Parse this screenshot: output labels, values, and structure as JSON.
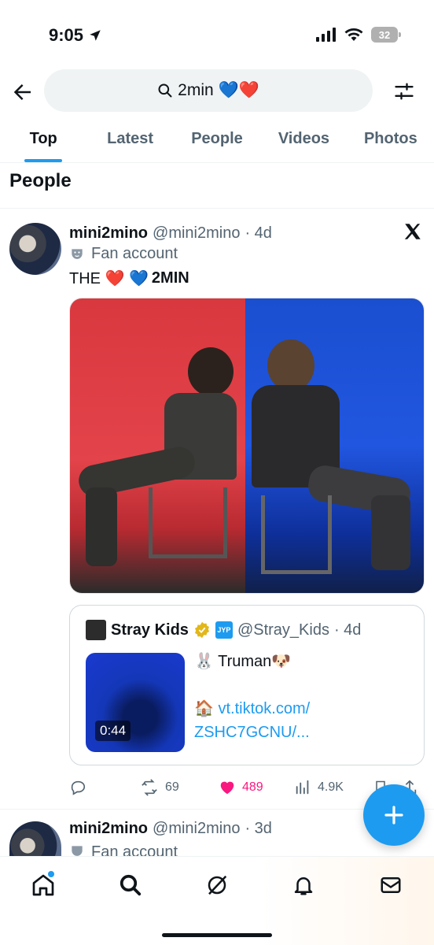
{
  "status_bar": {
    "time": "9:05",
    "battery": "32"
  },
  "search": {
    "query": "2min 💙❤️"
  },
  "tabs": [
    {
      "label": "Top",
      "active": true
    },
    {
      "label": "Latest",
      "active": false
    },
    {
      "label": "People",
      "active": false
    },
    {
      "label": "Videos",
      "active": false
    },
    {
      "label": "Photos",
      "active": false
    }
  ],
  "section_title": "People",
  "tweet": {
    "display_name": "mini2mino",
    "handle": "@mini2mino",
    "time": "· 4d",
    "account_label": "Fan account",
    "text_prefix": "THE ❤️ 💙",
    "text_bold": "2MIN",
    "quote": {
      "display_name": "Stray Kids",
      "handle": "@Stray_Kids",
      "time": "· 4d",
      "video_duration": "0:44",
      "line1": "🐰 Truman🐶",
      "line2_prefix": "🏠 ",
      "link_line1": "vt.tiktok.com/",
      "link_line2": "ZSHC7GCNU/..."
    },
    "actions": {
      "replies": "",
      "retweets": "69",
      "likes": "489",
      "views": "4.9K"
    }
  },
  "tweet2": {
    "display_name": "mini2mino",
    "handle": "@mini2mino",
    "time": "· 3d",
    "account_label": "Fan account"
  },
  "colors": {
    "accent": "#1d9bf0",
    "like": "#f91880",
    "secondary": "#536471"
  }
}
